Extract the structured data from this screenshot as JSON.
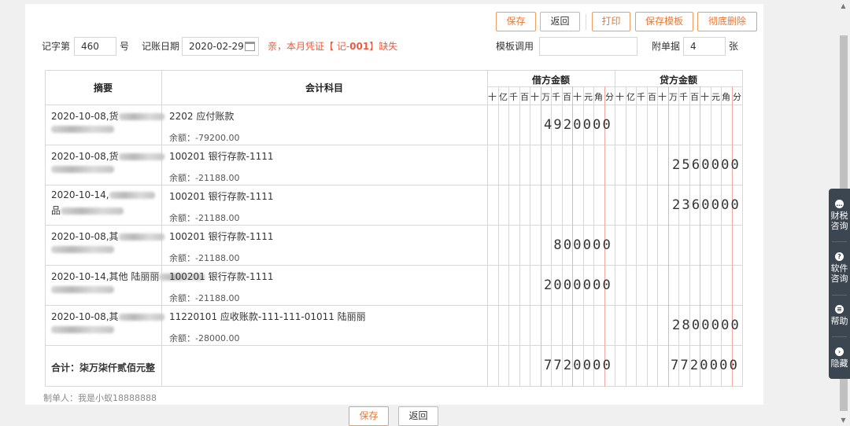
{
  "toolbar": {
    "save": "保存",
    "back": "返回",
    "print": "打印",
    "save_template": "保存模板",
    "delete_all": "彻底删除"
  },
  "voucher": {
    "word_label": "记字第",
    "number": "460",
    "number_suffix": "号",
    "date_label": "记账日期",
    "date": "2020-02-29",
    "warning_prefix": "亲，本月凭证【 记-",
    "warning_num": "001",
    "warning_suffix": "】缺失",
    "template_label": "模板调用",
    "template_value": "",
    "attach_label": "附单据",
    "attach_count": "4",
    "attach_unit": "张"
  },
  "table": {
    "col_summary": "摘要",
    "col_account": "会计科目",
    "col_debit": "借方金额",
    "col_credit": "贷方金额",
    "digit_headers": [
      "十",
      "亿",
      "千",
      "百",
      "十",
      "万",
      "千",
      "百",
      "十",
      "元",
      "角",
      "分"
    ],
    "rows": [
      {
        "summary1": "2020-10-08,货",
        "summary2": "",
        "account": "2202 应付账款",
        "balance": "余额：-79200.00",
        "debit": "4920000",
        "credit": ""
      },
      {
        "summary1": "2020-10-08,货",
        "summary2": "",
        "account": "100201 银行存款-1111",
        "balance": "余额：-21188.00",
        "debit": "",
        "credit": "2560000"
      },
      {
        "summary1": "2020-10-14,",
        "summary2": "品",
        "account": "100201 银行存款-1111",
        "balance": "余额：-21188.00",
        "debit": "",
        "credit": "2360000"
      },
      {
        "summary1": "2020-10-08,其",
        "summary2": "",
        "account": "100201 银行存款-1111",
        "balance": "余额：-21188.00",
        "debit": "800000",
        "credit": ""
      },
      {
        "summary1": "2020-10-14,其他 陆丽丽",
        "summary2": "",
        "account": "100201 银行存款-1111",
        "balance": "余额：-21188.00",
        "debit": "2000000",
        "credit": ""
      },
      {
        "summary1": "2020-10-08,其",
        "summary2": "",
        "account": "11220101 应收账款-111-111-01011 陆丽丽",
        "balance": "余额：-28000.00",
        "debit": "",
        "credit": "2800000"
      }
    ],
    "total_label": "合计：柒万柒仟贰佰元整",
    "total_debit": "7720000",
    "total_credit": "7720000"
  },
  "footer": {
    "maker": "制单人：我是小蚁18888888",
    "save": "保存",
    "back": "返回"
  },
  "side_menu": [
    {
      "icon": "…",
      "label1": "财税",
      "label2": "咨询"
    },
    {
      "icon": "?",
      "label1": "软件",
      "label2": "咨询"
    },
    {
      "icon": "≡",
      "label1": "帮助",
      "label2": ""
    },
    {
      "icon": "›",
      "label1": "隐藏",
      "label2": ""
    }
  ]
}
